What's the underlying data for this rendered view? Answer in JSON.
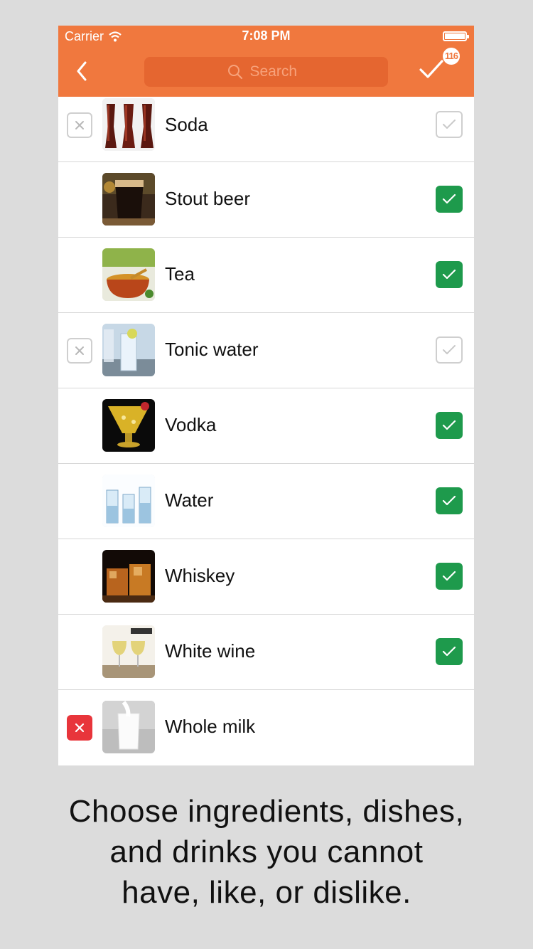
{
  "status": {
    "carrier": "Carrier",
    "time": "7:08 PM"
  },
  "toolbar": {
    "search_placeholder": "Search",
    "badge_count": "116",
    "accent_color": "#f0783e"
  },
  "items": [
    {
      "name": "Soda",
      "cannot_have": false,
      "cannot_visible": true,
      "like": false,
      "like_visible": true,
      "icon": "soda-glasses"
    },
    {
      "name": "Stout beer",
      "cannot_have": false,
      "cannot_visible": false,
      "like": true,
      "like_visible": true,
      "icon": "stout-pint"
    },
    {
      "name": "Tea",
      "cannot_have": false,
      "cannot_visible": false,
      "like": true,
      "like_visible": true,
      "icon": "tea-cup"
    },
    {
      "name": "Tonic water",
      "cannot_have": false,
      "cannot_visible": true,
      "like": false,
      "like_visible": true,
      "icon": "tonic-glass"
    },
    {
      "name": "Vodka",
      "cannot_have": false,
      "cannot_visible": false,
      "like": true,
      "like_visible": true,
      "icon": "vodka-cocktail"
    },
    {
      "name": "Water",
      "cannot_have": false,
      "cannot_visible": false,
      "like": true,
      "like_visible": true,
      "icon": "water-glasses"
    },
    {
      "name": "Whiskey",
      "cannot_have": false,
      "cannot_visible": false,
      "like": true,
      "like_visible": true,
      "icon": "whiskey-glasses"
    },
    {
      "name": "White wine",
      "cannot_have": false,
      "cannot_visible": false,
      "like": true,
      "like_visible": true,
      "icon": "wine-glasses"
    },
    {
      "name": "Whole milk",
      "cannot_have": true,
      "cannot_visible": true,
      "like": false,
      "like_visible": false,
      "icon": "milk-glass"
    }
  ],
  "caption": {
    "line1": "Choose ingredients, dishes,",
    "line2": "and drinks you cannot",
    "line3": "have, like, or dislike."
  }
}
